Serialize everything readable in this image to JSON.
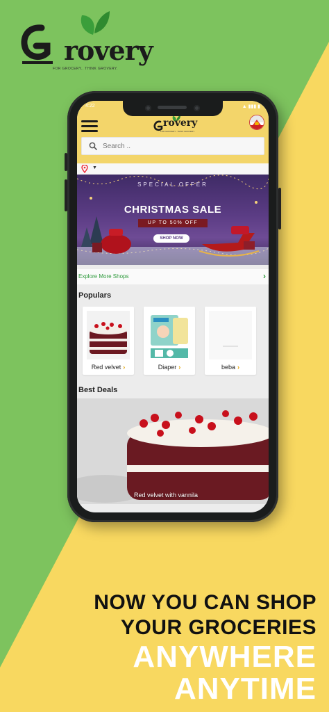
{
  "brand": {
    "name": "rovery",
    "tagline": "FOR GROCERY.. THINK GROVERY.",
    "colors": {
      "green": "#7dc35e",
      "yellow": "#f8d860",
      "app_yellow": "#f3d56a",
      "link_green": "#2e9a3c"
    }
  },
  "status_bar": {
    "time": "4:22",
    "icons": "▲ ▮▮▮ ▮"
  },
  "app": {
    "logo_text": "rovery",
    "logo_tagline": "FOR GROCERY.. THINK GROVERY.",
    "menu_icon": "hamburger-icon",
    "search": {
      "placeholder": "Search .."
    },
    "location": {
      "icon": "location-pin-icon",
      "chevron": "▼"
    },
    "banner": {
      "eyebrow": "SPECIAL OFFER",
      "title": "CHRISTMAS SALE",
      "subtitle": "UP TO 50% OFF",
      "cta": "SHOP NOW"
    },
    "explore": {
      "label": "Explore More Shops",
      "arrow": "›"
    },
    "populars": {
      "title": "Populars",
      "items": [
        {
          "label": "Red velvet",
          "chevron": "›"
        },
        {
          "label": "Diaper",
          "chevron": "›"
        },
        {
          "label": "beba",
          "chevron": "›"
        }
      ]
    },
    "best_deals": {
      "title": "Best Deals",
      "caption": "Red velvet with vannila"
    }
  },
  "headline": {
    "line1": "NOW YOU CAN SHOP",
    "line2": "YOUR GROCERIES",
    "line3": "ANYWHERE",
    "line4": "ANYTIME"
  }
}
